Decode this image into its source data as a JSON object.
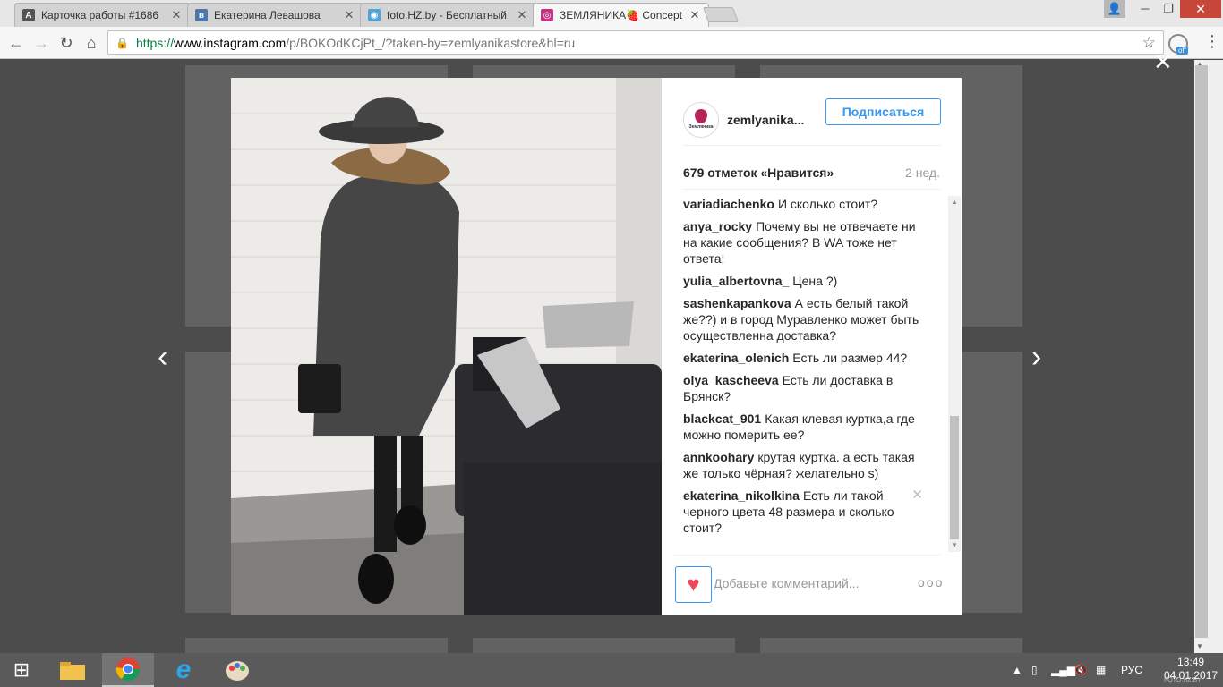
{
  "browser": {
    "tabs": [
      {
        "title": "Карточка работы #1686",
        "favicon": "A",
        "color": "#555555"
      },
      {
        "title": "Екатерина Левашова",
        "favicon": "vk",
        "color": "#4a76a8"
      },
      {
        "title": "foto.HZ.by - Бесплатный",
        "favicon": "hz",
        "color": "#4fa3d9"
      },
      {
        "title": "ЗЕМЛЯНИКА🍓 Concept",
        "favicon": "ig",
        "color": "#c13584",
        "active": true
      }
    ],
    "url_https": "https://",
    "url_host": "www.instagram.com",
    "url_path": "/p/BOKOdKCjPt_/?taken-by=zemlyanikastore&hl=ru",
    "ext_badge": "off"
  },
  "post": {
    "username": "zemlyanika...",
    "avatar_text": "Земляника",
    "follow_label": "Подписаться",
    "likes": "679 отметок «Нравится»",
    "time_ago": "2 нед.",
    "comments": [
      {
        "user": "variadiachenko",
        "text": "И сколько стоит?"
      },
      {
        "user": "anya_rocky",
        "text": "Почему вы не отвечаете ни на какие сообщения? В WA тоже нет ответа!"
      },
      {
        "user": "yulia_albertovna_",
        "text": "Цена ?)"
      },
      {
        "user": "sashenkapankova",
        "text": "А есть белый такой же??) и в город Муравленко может быть осуществленна доставка?"
      },
      {
        "user": "ekaterina_olenich",
        "text": "Есть ли размер 44?"
      },
      {
        "user": "olya_kascheeva",
        "text": "Есть ли доставка в Брянск?"
      },
      {
        "user": "blackcat_901",
        "text": "Какая клевая куртка,а где можно померить ее?"
      },
      {
        "user": "annkoohary",
        "text": "крутая куртка. а есть такая же только чёрная? желательно s)"
      },
      {
        "user": "ekaterina_nikolkina",
        "text": "Есть ли такой черного цвета 48 размера и сколько стоит?",
        "hover": true
      }
    ],
    "comment_placeholder": "Добавьте комментарий...",
    "more_label": "ooo"
  },
  "taskbar": {
    "lang": "РУС",
    "time": "13:49",
    "date": "04.01.2017",
    "watermark": "FOTO.HZ.BY"
  },
  "colors": {
    "accent": "#3897f0",
    "heart": "#ed4956",
    "overlay": "#4c4c4c"
  }
}
